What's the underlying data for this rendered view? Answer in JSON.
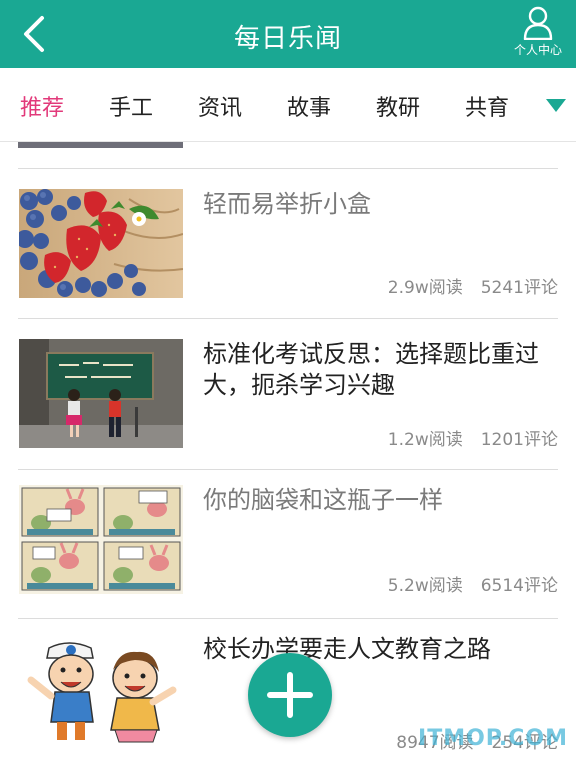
{
  "header": {
    "title": "每日乐闻",
    "back_icon": "chevron-left-icon",
    "user_icon": "user-icon",
    "user_label": "个人中心",
    "bg_color": "#1aa893"
  },
  "tabs": {
    "items": [
      {
        "label": "推荐",
        "active": true
      },
      {
        "label": "手工",
        "active": false
      },
      {
        "label": "资讯",
        "active": false
      },
      {
        "label": "故事",
        "active": false
      },
      {
        "label": "教研",
        "active": false
      },
      {
        "label": "共育",
        "active": false
      }
    ],
    "more_icon": "triangle-down-icon",
    "active_color": "#e2397a"
  },
  "feed": {
    "items": [
      {
        "title": "轻而易举折小盒",
        "reads": "2.9w阅读",
        "comments": "5241评论"
      },
      {
        "title": "标准化考试反思：选择题比重过大，扼杀学习兴趣",
        "reads": "1.2w阅读",
        "comments": "1201评论"
      },
      {
        "title": "你的脑袋和这瓶子一样",
        "reads": "5.2w阅读",
        "comments": "6514评论"
      },
      {
        "title": "校长办学要走人文教育之路",
        "reads": "8947阅读",
        "comments": "254评论"
      }
    ]
  },
  "fab": {
    "icon": "plus-icon"
  },
  "watermark": "ITMOP.COM"
}
